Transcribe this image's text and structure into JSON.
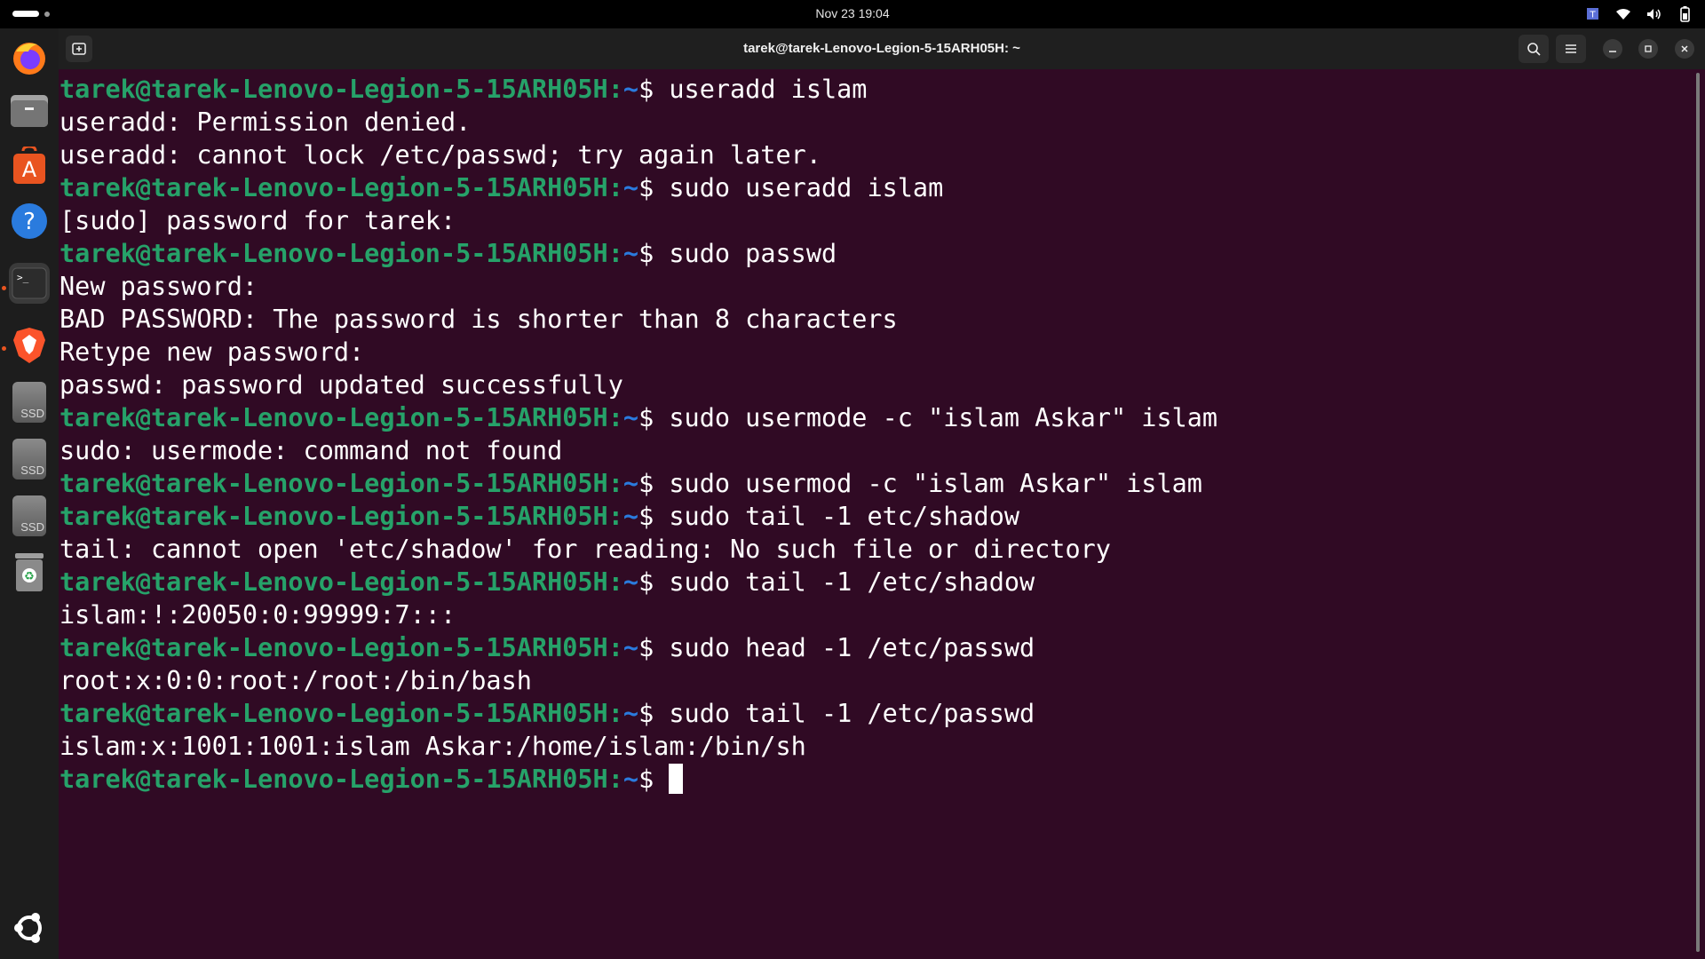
{
  "topbar": {
    "clock": "Nov 23  19:04"
  },
  "window": {
    "title": "tarek@tarek-Lenovo-Legion-5-15ARH05H: ~"
  },
  "dock": {
    "items": [
      {
        "name": "firefox"
      },
      {
        "name": "files"
      },
      {
        "name": "app-center"
      },
      {
        "name": "help"
      },
      {
        "name": "terminal"
      },
      {
        "name": "brave"
      },
      {
        "name": "ssd",
        "label": "SSD"
      },
      {
        "name": "ssd",
        "label": "SSD"
      },
      {
        "name": "ssd",
        "label": "SSD"
      },
      {
        "name": "trash"
      },
      {
        "name": "show-apps"
      }
    ]
  },
  "terminal": {
    "prompt_user": "tarek@tarek-Lenovo-Legion-5-15ARH05H",
    "prompt_sep": ":",
    "prompt_path": "~",
    "prompt_sign": "$ ",
    "lines": [
      {
        "type": "cmd",
        "text": "useradd islam"
      },
      {
        "type": "out",
        "text": "useradd: Permission denied."
      },
      {
        "type": "out",
        "text": "useradd: cannot lock /etc/passwd; try again later."
      },
      {
        "type": "cmd",
        "text": "sudo useradd islam"
      },
      {
        "type": "out",
        "text": "[sudo] password for tarek:"
      },
      {
        "type": "cmd",
        "text": "sudo passwd"
      },
      {
        "type": "out",
        "text": "New password:"
      },
      {
        "type": "out",
        "text": "BAD PASSWORD: The password is shorter than 8 characters"
      },
      {
        "type": "out",
        "text": "Retype new password:"
      },
      {
        "type": "out",
        "text": "passwd: password updated successfully"
      },
      {
        "type": "cmd",
        "text": "sudo usermode -c \"islam Askar\" islam"
      },
      {
        "type": "out",
        "text": "sudo: usermode: command not found"
      },
      {
        "type": "cmd",
        "text": "sudo usermod -c \"islam Askar\" islam"
      },
      {
        "type": "cmd",
        "text": "sudo tail -1 etc/shadow"
      },
      {
        "type": "out",
        "text": "tail: cannot open 'etc/shadow' for reading: No such file or directory"
      },
      {
        "type": "cmd",
        "text": "sudo tail -1 /etc/shadow"
      },
      {
        "type": "out",
        "text": "islam:!:20050:0:99999:7:::"
      },
      {
        "type": "cmd",
        "text": "sudo head -1 /etc/passwd"
      },
      {
        "type": "out",
        "text": "root:x:0:0:root:/root:/bin/bash"
      },
      {
        "type": "cmd",
        "text": "sudo tail -1 /etc/passwd"
      },
      {
        "type": "out",
        "text": "islam:x:1001:1001:islam Askar:/home/islam:/bin/sh"
      },
      {
        "type": "cmd",
        "text": ""
      }
    ]
  },
  "colors": {
    "background": "#300a24",
    "prompt_user": "#26a269",
    "prompt_path": "#2a7bde",
    "text": "#ffffff"
  }
}
